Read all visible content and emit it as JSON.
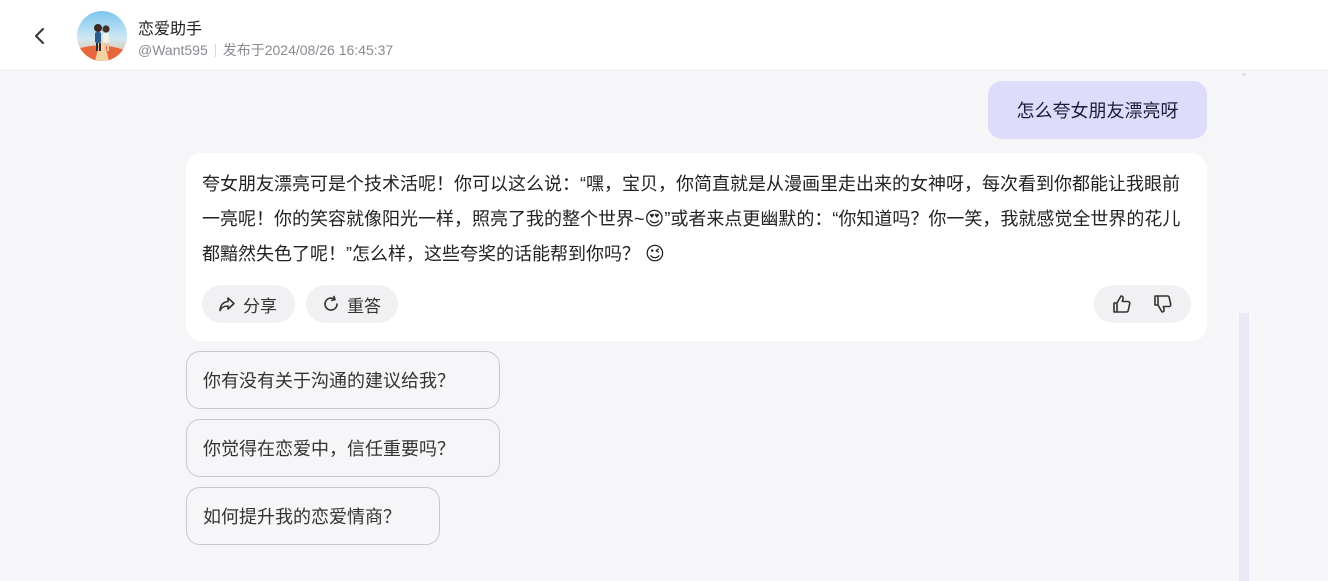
{
  "header": {
    "bot_name": "恋爱助手",
    "handle": "@Want595",
    "published": "发布于2024/08/26 16:45:37"
  },
  "icons": {
    "back": "chevron-left-icon",
    "share": "share-icon",
    "regenerate": "refresh-icon",
    "like": "thumbs-up-icon",
    "dislike": "thumbs-down-icon"
  },
  "user_message": "怎么夸女朋友漂亮呀",
  "bot_message": {
    "part1": "夸女朋友漂亮可是个技术活呢！你可以这么说：“嘿，宝贝，你简直就是从漫画里走出来的女神呀，每次看到你都能让我眼前一亮呢！你的笑容就像阳光一样，照亮了我的整个世界~",
    "emoji1": "😍",
    "part2": "”或者来点更幽默的：“你知道吗？你一笑，我就感觉全世界的花儿都黯然失色了呢！”怎么样，这些夸奖的话能帮到你吗？",
    "emoji2": "😉"
  },
  "actions": {
    "share_label": "分享",
    "regenerate_label": "重答"
  },
  "suggestions": [
    "你有没有关于沟通的建议给我？",
    "你觉得在恋爱中，信任重要吗？",
    "如何提升我的恋爱情商？"
  ],
  "colors": {
    "user_bubble": "#dedcfb",
    "background": "#f6f6f8",
    "card": "#ffffff"
  }
}
